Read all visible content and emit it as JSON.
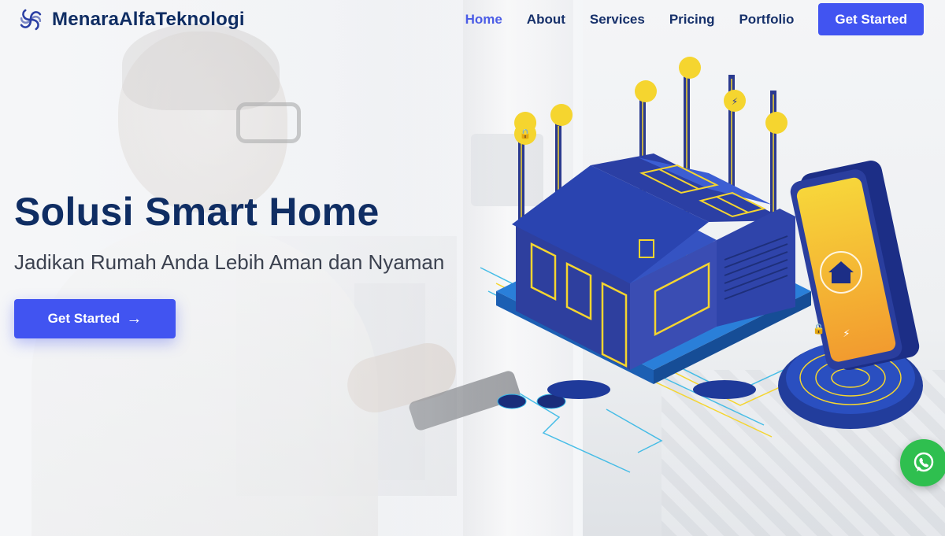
{
  "brand": {
    "name": "MenaraAlfaTeknologi",
    "icon": "swirl-logo-icon"
  },
  "nav": {
    "items": [
      {
        "label": "Home",
        "active": true
      },
      {
        "label": "About",
        "active": false
      },
      {
        "label": "Services",
        "active": false
      },
      {
        "label": "Pricing",
        "active": false
      },
      {
        "label": "Portfolio",
        "active": false
      }
    ],
    "cta_label": "Get Started"
  },
  "hero": {
    "title": "Solusi Smart Home",
    "subtitle": "Jadikan Rumah Anda Lebih Aman dan Nyaman",
    "cta_label": "Get Started",
    "cta_icon": "arrow-right-icon"
  },
  "floating": {
    "icon": "whatsapp-icon"
  },
  "colors": {
    "primary": "#4154f1",
    "heading": "#0f2d63",
    "nav_active": "#4b5ce6",
    "whatsapp": "#2fbf4f",
    "house_blue": "#2f3f9f",
    "accent_yellow": "#f5d52f"
  }
}
